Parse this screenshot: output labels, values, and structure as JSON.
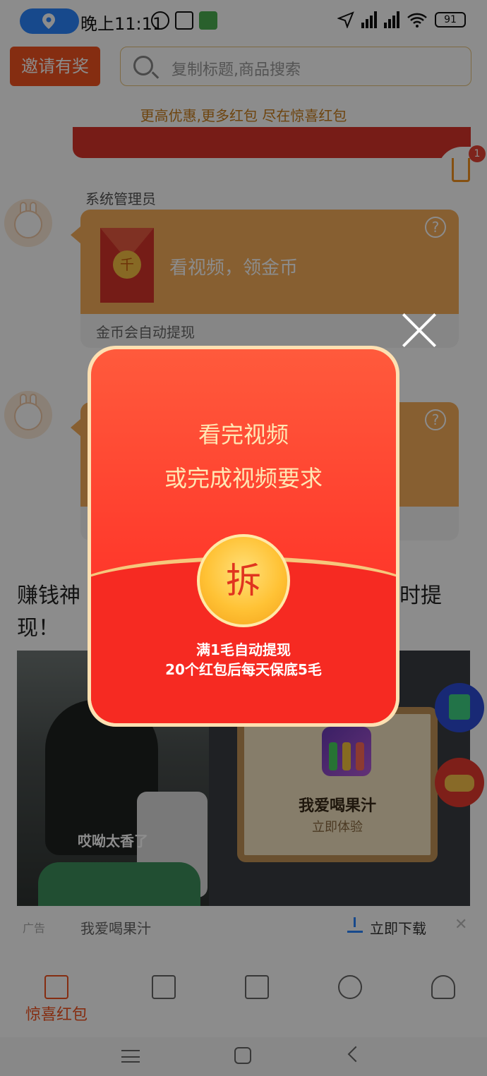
{
  "status_bar": {
    "time": "晚上11:11",
    "battery": "91"
  },
  "header": {
    "invite_label": "邀请有奖",
    "search_placeholder": "复制标题,商品搜索"
  },
  "slogan": "更高优惠,更多红包 尽在惊喜红包",
  "download_badge": "1",
  "messages": [
    {
      "sender": "系统管理员",
      "card_text": "看视频，领金币",
      "coin_char": "千",
      "footer": "金币会自动提现"
    },
    {
      "sender": "",
      "card_text": "",
      "footer": ""
    }
  ],
  "headline": "赚钱神器，…时提现！",
  "headline_left": "赚钱神",
  "headline_right": "时提",
  "headline_line2": "现！",
  "ad": {
    "left_caption": "哎呦太香了",
    "game_title": "我爱喝果汁",
    "game_sub": "立即体验",
    "tag": "广告",
    "name": "我爱喝果汁",
    "download_label": "立即下载"
  },
  "tabs": [
    {
      "label": "惊喜红包",
      "icon": "red-envelope-icon",
      "active": true
    },
    {
      "label": "",
      "icon": "mystery-box-icon",
      "active": false
    },
    {
      "label": "",
      "icon": "shopping-bag-icon",
      "active": false
    },
    {
      "label": "",
      "icon": "gift-icon",
      "active": false
    },
    {
      "label": "",
      "icon": "person-icon",
      "active": false
    }
  ],
  "modal": {
    "line1": "看完视频",
    "line2": "或完成视频要求",
    "open_char": "拆",
    "note1": "满1毛自动提现",
    "note2": "20个红包后每天保底5毛"
  },
  "colors": {
    "accent": "#f2521f",
    "packet_red": "#ff3b2c",
    "gold": "#ffc235",
    "bubble": "#f6ad5a"
  }
}
